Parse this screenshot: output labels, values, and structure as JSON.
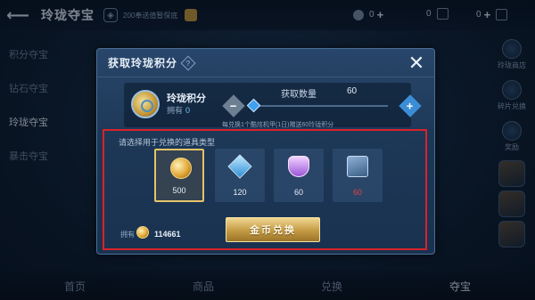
{
  "topbar": {
    "title": "玲珑夺宝",
    "vip_text": "200奉送值暂保底",
    "currency_1": "0",
    "currency_2": "0",
    "currency_3": "0"
  },
  "sidenav": {
    "items": [
      {
        "label": "积分夺宝"
      },
      {
        "label": "钻石夺宝"
      },
      {
        "label": "玲珑夺宝"
      },
      {
        "label": "暴击夺宝"
      }
    ]
  },
  "rightcol": {
    "items": [
      {
        "label": "玲珑商店"
      },
      {
        "label": "碎片兑换"
      },
      {
        "label": "奖励"
      }
    ]
  },
  "bottomnav": {
    "tabs": [
      {
        "label": "首页"
      },
      {
        "label": "商品"
      },
      {
        "label": "兑换"
      },
      {
        "label": "夺宝"
      }
    ]
  },
  "modal": {
    "title": "获取玲珑积分",
    "help": "?",
    "close": "✕",
    "item_name": "玲珑积分",
    "owned_label": "拥有",
    "owned_value": "0",
    "quantity_label": "获取数量",
    "quantity_value": "60",
    "minus": "−",
    "plus": "+",
    "note": "每兑换1个酷炫机甲(1日)赠送60玲珑积分",
    "quantity_fraction": 0.0
  },
  "exchange": {
    "prompt": "请选择用于兑换的道具类型",
    "options": [
      {
        "icon": "gold-coin-icon",
        "value": "500",
        "selected": true
      },
      {
        "icon": "diamond-icon",
        "value": "120",
        "selected": false
      },
      {
        "icon": "crystal-icon",
        "value": "60",
        "selected": false
      },
      {
        "icon": "voucher-card-icon",
        "value": "60",
        "selected": false
      }
    ],
    "balance_label": "拥有",
    "balance_value": "114661",
    "button_label": "金币兑换"
  },
  "colors": {
    "highlight_box": "#d8232a",
    "selected_border": "#e3c46a",
    "insufficient_value": "#e34444",
    "accent_blue": "#3fa0ef"
  }
}
